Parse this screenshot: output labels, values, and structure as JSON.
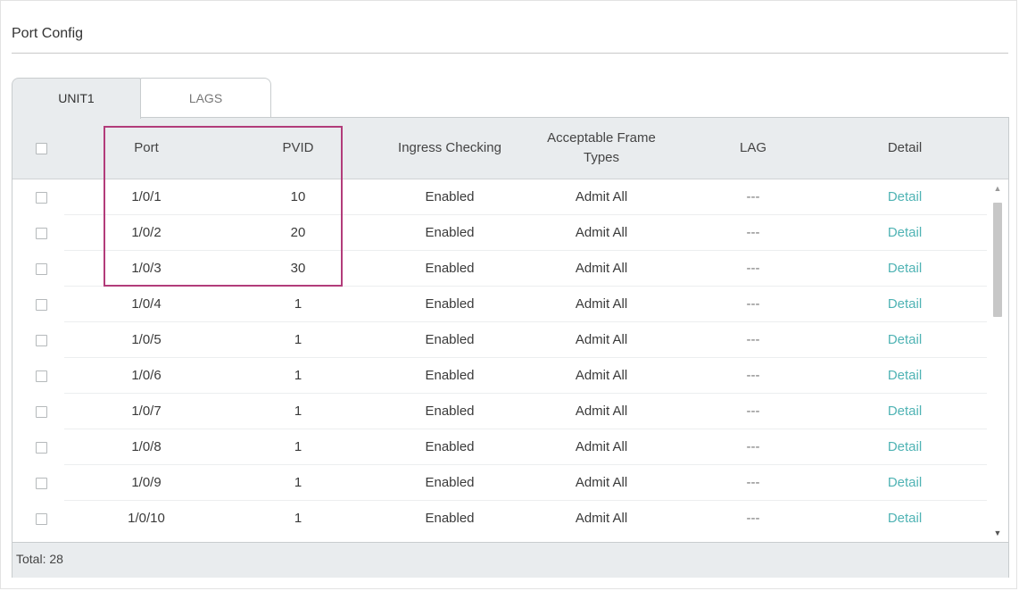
{
  "section": {
    "title": "Port Config"
  },
  "tabs": [
    {
      "label": "UNIT1",
      "active": true
    },
    {
      "label": "LAGS",
      "active": false
    }
  ],
  "table": {
    "headers": {
      "port": "Port",
      "pvid": "PVID",
      "ingress": "Ingress Checking",
      "frame_line1": "Acceptable Frame",
      "frame_line2": "Types",
      "lag": "LAG",
      "detail": "Detail"
    },
    "rows": [
      {
        "port": "1/0/1",
        "pvid": "10",
        "ingress": "Enabled",
        "frame": "Admit All",
        "lag": "---",
        "detail": "Detail"
      },
      {
        "port": "1/0/2",
        "pvid": "20",
        "ingress": "Enabled",
        "frame": "Admit All",
        "lag": "---",
        "detail": "Detail"
      },
      {
        "port": "1/0/3",
        "pvid": "30",
        "ingress": "Enabled",
        "frame": "Admit All",
        "lag": "---",
        "detail": "Detail"
      },
      {
        "port": "1/0/4",
        "pvid": "1",
        "ingress": "Enabled",
        "frame": "Admit All",
        "lag": "---",
        "detail": "Detail"
      },
      {
        "port": "1/0/5",
        "pvid": "1",
        "ingress": "Enabled",
        "frame": "Admit All",
        "lag": "---",
        "detail": "Detail"
      },
      {
        "port": "1/0/6",
        "pvid": "1",
        "ingress": "Enabled",
        "frame": "Admit All",
        "lag": "---",
        "detail": "Detail"
      },
      {
        "port": "1/0/7",
        "pvid": "1",
        "ingress": "Enabled",
        "frame": "Admit All",
        "lag": "---",
        "detail": "Detail"
      },
      {
        "port": "1/0/8",
        "pvid": "1",
        "ingress": "Enabled",
        "frame": "Admit All",
        "lag": "---",
        "detail": "Detail"
      },
      {
        "port": "1/0/9",
        "pvid": "1",
        "ingress": "Enabled",
        "frame": "Admit All",
        "lag": "---",
        "detail": "Detail"
      },
      {
        "port": "1/0/10",
        "pvid": "1",
        "ingress": "Enabled",
        "frame": "Admit All",
        "lag": "---",
        "detail": "Detail"
      }
    ],
    "footer": {
      "total": "Total: 28"
    }
  },
  "scrollbar": {
    "up_icon": "▲",
    "down_icon": "▼"
  },
  "colors": {
    "accent_link": "#4fb3b4",
    "highlight_border": "#b23c7a",
    "header_bg": "#e9ecee"
  },
  "icons": {
    "checkbox": "checkbox-icon",
    "scroll_up": "chevron-up-icon",
    "scroll_down": "chevron-down-icon"
  }
}
